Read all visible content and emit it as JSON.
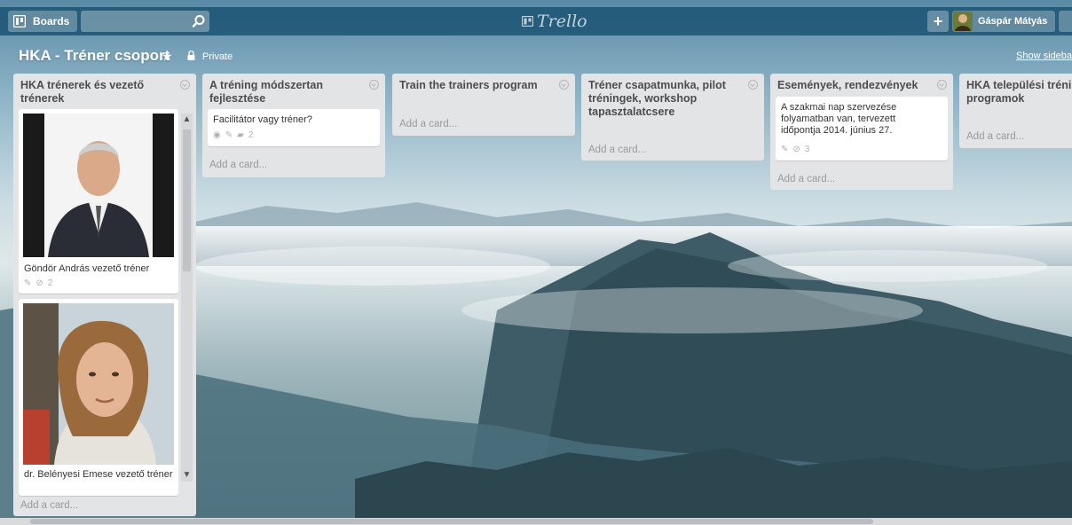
{
  "header": {
    "boards_label": "Boards",
    "search_placeholder": "",
    "logo_text": "Trello",
    "add_label": "+",
    "member_name": "Gáspár Mátyás"
  },
  "board": {
    "title": "HKA - Tréner csoport",
    "star": "★",
    "privacy": "Private",
    "show_sidebar": "Show sidebar"
  },
  "lists": [
    {
      "title": "HKA trénerek és vezető trénerek",
      "cards": [
        {
          "title": "Göndör András vezető tréner",
          "badges": {
            "attachments": "2"
          }
        },
        {
          "title": "dr. Belényesi Emese vezető tréner"
        }
      ],
      "add_card": "Add a card..."
    },
    {
      "title": "A tréning módszertan fejlesztése",
      "cards": [
        {
          "title": "Facilitátor vagy tréner?",
          "badges": {
            "comments": "2"
          }
        }
      ],
      "add_card": "Add a card..."
    },
    {
      "title": "Train the trainers program",
      "cards": [],
      "add_card": "Add a card..."
    },
    {
      "title": "Tréner csapatmunka, pilot tréningek, workshop tapasztalatcsere",
      "cards": [],
      "add_card": "Add a card..."
    },
    {
      "title": "Események, rendezvények",
      "cards": [
        {
          "title": "A szakmai nap szervezése folyamatban van, tervezett időpontja 2014. június 27.",
          "badges": {
            "attachments": "3"
          }
        }
      ],
      "add_card": "Add a card..."
    },
    {
      "title": "HKA települési tréning programok",
      "cards": [],
      "add_card": "Add a card..."
    }
  ],
  "icons": {
    "boards": "boards-icon",
    "search": "search-icon",
    "lock": "lock-icon",
    "description": "eye-icon",
    "edit": "pencil-icon",
    "comment": "comment-icon",
    "attachment": "paperclip-icon"
  }
}
